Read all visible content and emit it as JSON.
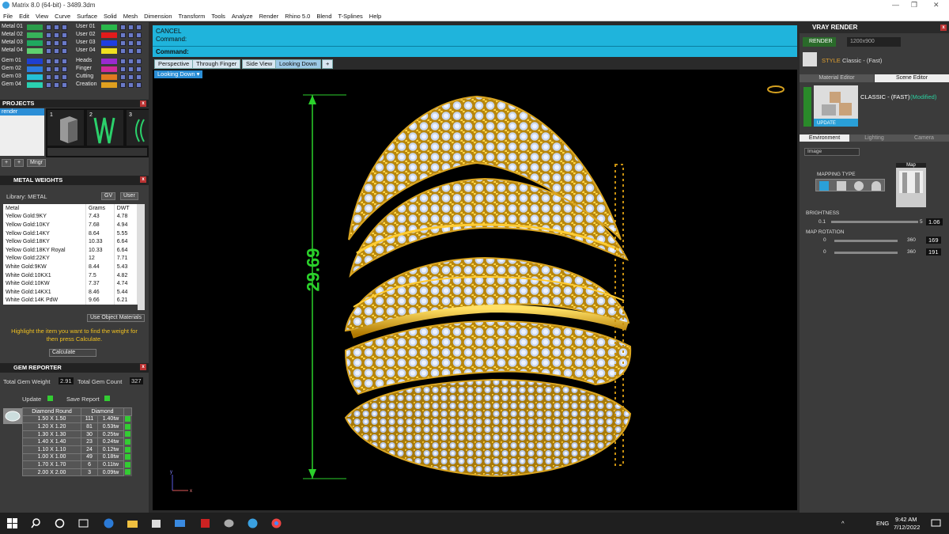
{
  "window": {
    "title": "Matrix 8.0 (64-bit) - 3489.3dm",
    "minimize_glyph": "—",
    "restore_glyph": "❐",
    "close_glyph": "✕"
  },
  "menu": [
    "File",
    "Edit",
    "View",
    "Curve",
    "Surface",
    "Solid",
    "Mesh",
    "Dimension",
    "Transform",
    "Tools",
    "Analyze",
    "Render",
    "Rhino 5.0",
    "Blend",
    "T-Splines",
    "Help"
  ],
  "layers": {
    "left": [
      {
        "name": "Metal 01",
        "color": "#2a9d4a"
      },
      {
        "name": "Metal 02",
        "color": "#37b35a"
      },
      {
        "name": "Metal 03",
        "color": "#1fa85f"
      },
      {
        "name": "Metal 04",
        "color": "#5fd06f"
      }
    ],
    "right": [
      {
        "name": "User 01",
        "color": "#2ab84a"
      },
      {
        "name": "User 02",
        "color": "#e21b1b"
      },
      {
        "name": "User 03",
        "color": "#1f3ee0"
      },
      {
        "name": "User 04",
        "color": "#f0e020"
      }
    ],
    "left2": [
      {
        "name": "Gem 01",
        "color": "#1f3fd0"
      },
      {
        "name": "Gem 02",
        "color": "#2a7ae0"
      },
      {
        "name": "Gem 03",
        "color": "#24c0d6"
      },
      {
        "name": "Gem 04",
        "color": "#2ad0b0"
      }
    ],
    "right2": [
      {
        "name": "Heads",
        "color": "#9a2ad0"
      },
      {
        "name": "Finger",
        "color": "#d02a9a"
      },
      {
        "name": "Cutting",
        "color": "#e07a1f"
      },
      {
        "name": "Creation",
        "color": "#e0a01f"
      }
    ]
  },
  "projects": {
    "title": "PROJECTS",
    "item": "render",
    "thumbs": [
      "1",
      "2",
      "3"
    ],
    "btn_plus": "+",
    "btn_up": "+",
    "btn_mngr": "Mngr"
  },
  "metal_weights": {
    "title": "METAL WEIGHTS",
    "library_label": "Library: METAL",
    "cols": [
      "Metal",
      "Grams",
      "DWT"
    ],
    "rows": [
      [
        "Yellow Gold:9KY",
        "7.43",
        "4.78"
      ],
      [
        "Yellow Gold:10KY",
        "7.68",
        "4.94"
      ],
      [
        "Yellow Gold:14KY",
        "8.64",
        "5.55"
      ],
      [
        "Yellow Gold:18KY",
        "10.33",
        "6.64"
      ],
      [
        "Yellow Gold:18KY Royal",
        "10.33",
        "6.64"
      ],
      [
        "Yellow Gold:22KY",
        "12",
        "7.71"
      ],
      [
        "White Gold:9KW",
        "8.44",
        "5.43"
      ],
      [
        "White Gold:10KX1",
        "7.5",
        "4.82"
      ],
      [
        "White Gold:10KW",
        "7.37",
        "4.74"
      ],
      [
        "White Gold:14KX1",
        "8.46",
        "5.44"
      ],
      [
        "White Gold:14K PdW",
        "9.66",
        "6.21"
      ]
    ],
    "use_object_materials": "Use Object Materials",
    "hint": "Highlight the item you want to find the weight for then press Calculate.",
    "calculate": "Calculate",
    "gv": "GV",
    "user": "User"
  },
  "gem_reporter": {
    "title": "GEM REPORTER",
    "total_weight_label": "Total Gem Weight",
    "total_weight": "2.91",
    "total_count_label": "Total Gem Count",
    "total_count": "327",
    "update": "Update",
    "save_report": "Save Report",
    "cols": [
      "Diamond Round",
      "Diamond"
    ],
    "rows": [
      [
        "1.50 X 1.50",
        "111",
        "1.40tw"
      ],
      [
        "1.20 X 1.20",
        "81",
        "0.53tw"
      ],
      [
        "1.30 X 1.30",
        "30",
        "0.25tw"
      ],
      [
        "1.40 X 1.40",
        "23",
        "0.24tw"
      ],
      [
        "1.10 X 1.10",
        "24",
        "0.12tw"
      ],
      [
        "1.00 X 1.00",
        "49",
        "0.18tw"
      ],
      [
        "1.70 X 1.70",
        "6",
        "0.11tw"
      ],
      [
        "2.00 X 2.00",
        "3",
        "0.09tw"
      ]
    ]
  },
  "command": {
    "line1": "CANCEL",
    "line2": "Command:",
    "prompt": "Command:"
  },
  "viewport_tabs": [
    "Perspective",
    "Through Finger",
    "Side View",
    "Looking Down"
  ],
  "active_tab": "Looking Down",
  "add_tab": "+",
  "viewport_label": "Looking Down",
  "dimension": "29.69",
  "axis": {
    "y": "y",
    "x": "x"
  },
  "vray": {
    "title": "VRAY RENDER",
    "render": "RENDER",
    "resolution": "1200x900",
    "style_label": "STYLE",
    "style_value": "Classic - (Fast)",
    "tabs": [
      "Material Editor",
      "Scene Editor"
    ],
    "preset": "CLASSIC - (FAST)",
    "modified": "(Modified)",
    "update": "UPDATE",
    "env_tabs": [
      "Environment",
      "Lighting",
      "Camera"
    ],
    "env_dropdown": "Image",
    "mapping_type": "MAPPING TYPE",
    "map": "Map",
    "brightness_label": "BRIGHTNESS",
    "brightness_min": "0.1",
    "brightness_max": "5",
    "brightness_val": "1.06",
    "map_rotation_label": "MAP ROTATION",
    "rot_min": "0",
    "rot_max": "360",
    "rot1": "169",
    "rot2": "191"
  },
  "taskbar": {
    "lang": "ENG",
    "time": "9:42 AM",
    "date": "7/12/2022"
  }
}
